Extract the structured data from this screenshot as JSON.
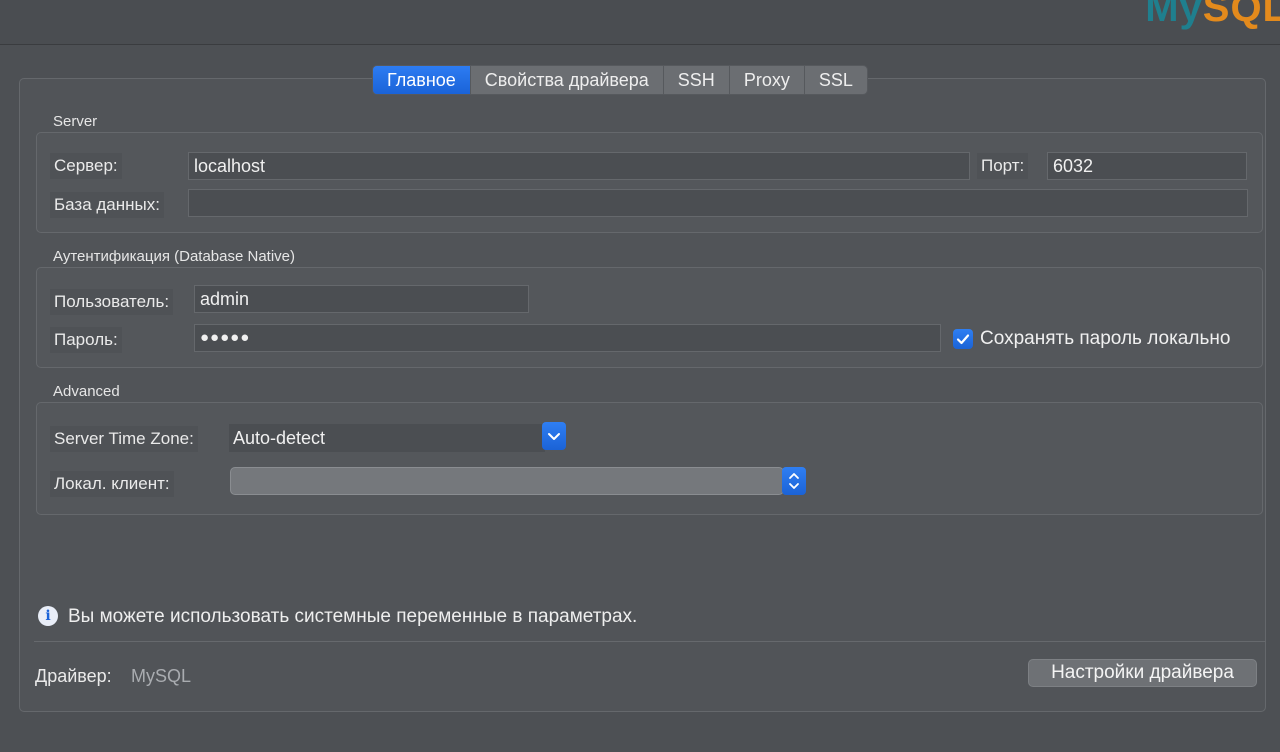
{
  "logo": {
    "part1": "My",
    "part2": "SQL"
  },
  "tabs": [
    {
      "label": "Главное",
      "active": true
    },
    {
      "label": "Свойства драйвера",
      "active": false
    },
    {
      "label": "SSH",
      "active": false
    },
    {
      "label": "Proxy",
      "active": false
    },
    {
      "label": "SSL",
      "active": false
    }
  ],
  "server": {
    "section_title": "Server",
    "host_label": "Сервер:",
    "host_value": "localhost",
    "port_label": "Порт:",
    "port_value": "6032",
    "database_label": "База данных:",
    "database_value": ""
  },
  "auth": {
    "section_title": "Аутентификация (Database Native)",
    "user_label": "Пользователь:",
    "user_value": "admin",
    "password_label": "Пароль:",
    "password_mask": "●●●●●",
    "save_password_label": "Сохранять пароль локально",
    "save_password_checked": true
  },
  "advanced": {
    "section_title": "Advanced",
    "timezone_label": "Server Time Zone:",
    "timezone_value": "Auto-detect",
    "local_client_label": "Локал. клиент:",
    "local_client_value": ""
  },
  "info": {
    "text": "Вы можете использовать системные переменные в параметрах."
  },
  "footer": {
    "driver_label": "Драйвер:",
    "driver_value": "MySQL",
    "driver_settings_button": "Настройки драйвера"
  },
  "colors": {
    "accent": "#1a63d8",
    "background": "#4d5054",
    "logo_my": "#1f7f8e",
    "logo_sql": "#e38a1c"
  }
}
